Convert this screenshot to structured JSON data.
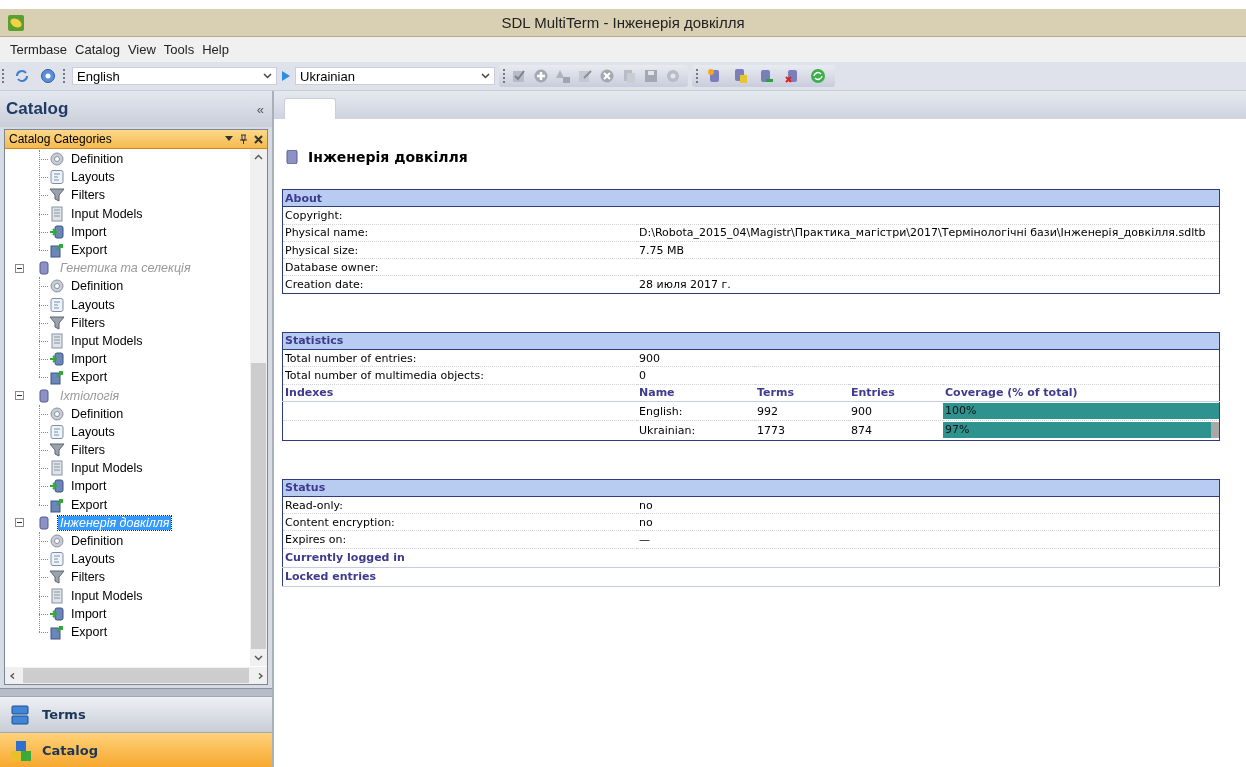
{
  "window": {
    "title": "SDL MultiTerm - Інженерія довкілля"
  },
  "menu": [
    "Termbase",
    "Catalog",
    "View",
    "Tools",
    "Help"
  ],
  "toolbar": {
    "source_language": "English",
    "target_language": "Ukrainian"
  },
  "sidebar": {
    "title": "Catalog",
    "collapse": "«",
    "panel_title": "Catalog Categories",
    "tree": [
      {
        "children": [
          {
            "label": "Definition",
            "kind": "definition"
          },
          {
            "label": "Layouts",
            "kind": "layouts"
          },
          {
            "label": "Filters",
            "kind": "filters"
          },
          {
            "label": "Input Models",
            "kind": "input_models"
          },
          {
            "label": "Import",
            "kind": "import"
          },
          {
            "label": "Export",
            "kind": "export"
          }
        ]
      },
      {
        "label": "Генетика та селекція",
        "expanded": true,
        "selected": false,
        "children": [
          {
            "label": "Definition",
            "kind": "definition"
          },
          {
            "label": "Layouts",
            "kind": "layouts"
          },
          {
            "label": "Filters",
            "kind": "filters"
          },
          {
            "label": "Input Models",
            "kind": "input_models"
          },
          {
            "label": "Import",
            "kind": "import"
          },
          {
            "label": "Export",
            "kind": "export"
          }
        ]
      },
      {
        "label": "Іхтіологія",
        "expanded": true,
        "selected": false,
        "children": [
          {
            "label": "Definition",
            "kind": "definition"
          },
          {
            "label": "Layouts",
            "kind": "layouts"
          },
          {
            "label": "Filters",
            "kind": "filters"
          },
          {
            "label": "Input Models",
            "kind": "input_models"
          },
          {
            "label": "Import",
            "kind": "import"
          },
          {
            "label": "Export",
            "kind": "export"
          }
        ]
      },
      {
        "label": "Інженерія довкілля",
        "expanded": true,
        "selected": true,
        "children": [
          {
            "label": "Definition",
            "kind": "definition"
          },
          {
            "label": "Layouts",
            "kind": "layouts"
          },
          {
            "label": "Filters",
            "kind": "filters"
          },
          {
            "label": "Input Models",
            "kind": "input_models"
          },
          {
            "label": "Import",
            "kind": "import"
          },
          {
            "label": "Export",
            "kind": "export"
          }
        ]
      }
    ],
    "nav_buttons": [
      {
        "label": "Terms",
        "kind": "terms",
        "selected": false
      },
      {
        "label": "Catalog",
        "kind": "catalog",
        "selected": true
      }
    ]
  },
  "content": {
    "heading": "Інженерія довкілля",
    "about": {
      "title": "About",
      "rows": [
        {
          "label": "Copyright:"
        },
        {
          "label": "Physical name:",
          "value": "D:\\Robota_2015_04\\Magistr\\Практика_магістри\\2017\\Термінологічні бази\\Інженерія_довкілля.sdltb"
        },
        {
          "label": "Physical size:",
          "value": "7.75 MB"
        },
        {
          "label": "Database owner:"
        },
        {
          "label": "Creation date:",
          "value": "28 июля 2017 г."
        }
      ]
    },
    "statistics": {
      "title": "Statistics",
      "rows": [
        {
          "label": "Total number of entries:",
          "value": "900"
        },
        {
          "label": "Total number of multimedia objects:",
          "value": "0"
        }
      ],
      "indexes": {
        "title": "Indexes",
        "columns": [
          "Name",
          "Terms",
          "Entries",
          "Coverage (% of total)"
        ],
        "rows": [
          {
            "name": "English:",
            "terms": "992",
            "entries": "900",
            "coverage": "100%",
            "level": 1.0
          },
          {
            "name": "Ukrainian:",
            "terms": "1773",
            "entries": "874",
            "coverage": "97%",
            "level": 0.97
          }
        ]
      }
    },
    "status": {
      "title": "Status",
      "rows": [
        {
          "label": "Read-only:",
          "value": "no"
        },
        {
          "label": "Content encryption:",
          "value": "no"
        },
        {
          "label": "Expires on:",
          "value": "—"
        }
      ],
      "subsections": [
        "Currently logged in",
        "Locked entries"
      ]
    }
  }
}
